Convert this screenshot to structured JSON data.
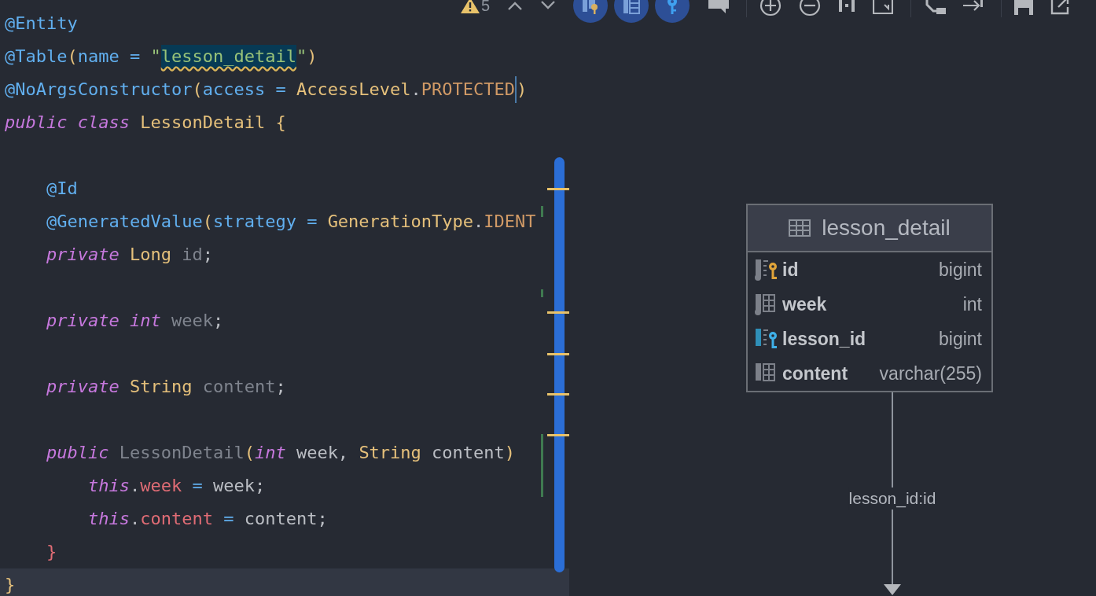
{
  "editor": {
    "lines": [
      {
        "kind": "code",
        "current": false,
        "tokens": [
          {
            "t": "@Entity",
            "kind": "ann"
          }
        ]
      },
      {
        "kind": "code",
        "current": false,
        "tokens": [
          {
            "t": "@Table",
            "kind": "ann"
          },
          {
            "t": "(",
            "kind": "br"
          },
          {
            "t": "name = ",
            "kind": "ann"
          },
          {
            "t": "\"",
            "kind": "str"
          },
          {
            "t": "lesson_detail",
            "kind": "strhl"
          },
          {
            "t": "\"",
            "kind": "str"
          },
          {
            "t": ")",
            "kind": "br"
          }
        ]
      },
      {
        "kind": "code",
        "current": false,
        "tokens": [
          {
            "t": "@NoArgsConstructor",
            "kind": "ann"
          },
          {
            "t": "(",
            "kind": "br"
          },
          {
            "t": "access = ",
            "kind": "ann"
          },
          {
            "t": "AccessLevel",
            "kind": "type"
          },
          {
            "t": ".",
            "kind": "plain"
          },
          {
            "t": "PROTECTED",
            "kind": "const",
            "caret": true
          },
          {
            "t": ")",
            "kind": "br"
          }
        ]
      },
      {
        "kind": "code",
        "current": false,
        "tokens": [
          {
            "t": "public class ",
            "kind": "kw"
          },
          {
            "t": "LessonDetail ",
            "kind": "type"
          },
          {
            "t": "{",
            "kind": "br"
          }
        ]
      },
      {
        "kind": "blank",
        "current": false
      },
      {
        "kind": "code",
        "current": false,
        "tokens": [
          {
            "t": "    @Id",
            "kind": "ann"
          }
        ]
      },
      {
        "kind": "code",
        "current": false,
        "tokens": [
          {
            "t": "    @GeneratedValue",
            "kind": "ann"
          },
          {
            "t": "(",
            "kind": "br"
          },
          {
            "t": "strategy = ",
            "kind": "ann"
          },
          {
            "t": "GenerationType",
            "kind": "type"
          },
          {
            "t": ".",
            "kind": "plain"
          },
          {
            "t": "IDENT",
            "kind": "const"
          }
        ]
      },
      {
        "kind": "code",
        "current": false,
        "tokens": [
          {
            "t": "    private ",
            "kind": "kw"
          },
          {
            "t": "Long ",
            "kind": "type"
          },
          {
            "t": "id",
            "kind": "dim"
          },
          {
            "t": ";",
            "kind": "plain"
          }
        ]
      },
      {
        "kind": "blank",
        "current": false
      },
      {
        "kind": "code",
        "current": false,
        "tokens": [
          {
            "t": "    private int ",
            "kind": "kw"
          },
          {
            "t": "week",
            "kind": "dim"
          },
          {
            "t": ";",
            "kind": "plain"
          }
        ]
      },
      {
        "kind": "blank",
        "current": false
      },
      {
        "kind": "code",
        "current": false,
        "tokens": [
          {
            "t": "    private ",
            "kind": "kw"
          },
          {
            "t": "String ",
            "kind": "type"
          },
          {
            "t": "content",
            "kind": "dim"
          },
          {
            "t": ";",
            "kind": "plain"
          }
        ]
      },
      {
        "kind": "blank",
        "current": false
      },
      {
        "kind": "code",
        "current": false,
        "tokens": [
          {
            "t": "    public ",
            "kind": "kw"
          },
          {
            "t": "LessonDetail",
            "kind": "dim"
          },
          {
            "t": "(",
            "kind": "br"
          },
          {
            "t": "int ",
            "kind": "kw"
          },
          {
            "t": "week, ",
            "kind": "plain"
          },
          {
            "t": "String ",
            "kind": "type"
          },
          {
            "t": "content",
            "kind": "plain"
          },
          {
            "t": ")",
            "kind": "br"
          }
        ]
      },
      {
        "kind": "code",
        "current": false,
        "tokens": [
          {
            "t": "        this",
            "kind": "kw"
          },
          {
            "t": ".",
            "kind": "plain"
          },
          {
            "t": "week",
            "kind": "field"
          },
          {
            "t": " = ",
            "kind": "op"
          },
          {
            "t": "week;",
            "kind": "plain"
          }
        ]
      },
      {
        "kind": "code",
        "current": false,
        "tokens": [
          {
            "t": "        this",
            "kind": "kw"
          },
          {
            "t": ".",
            "kind": "plain"
          },
          {
            "t": "content",
            "kind": "field"
          },
          {
            "t": " = ",
            "kind": "op"
          },
          {
            "t": "content;",
            "kind": "plain"
          }
        ]
      },
      {
        "kind": "code",
        "current": false,
        "tokens": [
          {
            "t": "    }",
            "kind": "br2"
          }
        ]
      },
      {
        "kind": "code",
        "current": true,
        "tokens": [
          {
            "t": "}",
            "kind": "br"
          }
        ]
      }
    ]
  },
  "toolbar": {
    "warning_count": "5",
    "toggles": [
      {
        "selected": true
      },
      {
        "selected": true
      },
      {
        "selected": true
      }
    ]
  },
  "diagram": {
    "table": {
      "title": "lesson_detail",
      "columns": [
        {
          "name": "id",
          "type": "bigint",
          "kind": "primary"
        },
        {
          "name": "week",
          "type": "int",
          "kind": "column"
        },
        {
          "name": "lesson_id",
          "type": "bigint",
          "kind": "foreign"
        },
        {
          "name": "content",
          "type": "varchar(255)",
          "kind": "plain"
        }
      ]
    },
    "link": {
      "label": "lesson_id:id"
    }
  }
}
